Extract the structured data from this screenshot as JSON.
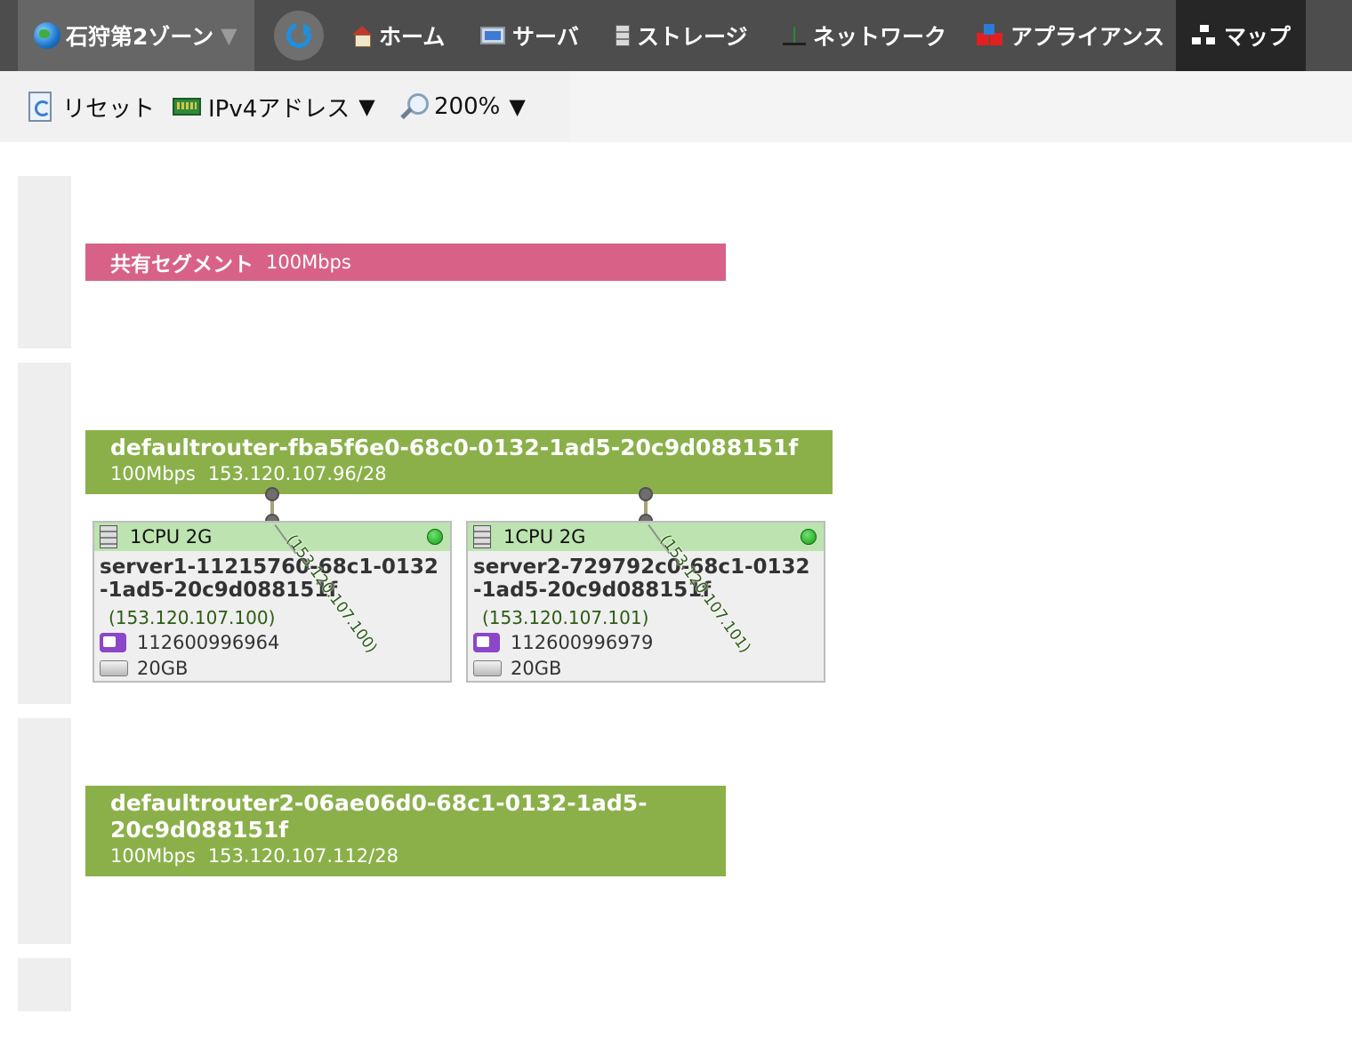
{
  "nav": {
    "zone": "石狩第2ゾーン",
    "zone_caret": "▼",
    "items": [
      {
        "label": "ホーム",
        "icon": "home-icon"
      },
      {
        "label": "サーバ",
        "icon": "server-icon"
      },
      {
        "label": "ストレージ",
        "icon": "storage-icon"
      },
      {
        "label": "ネットワーク",
        "icon": "network-icon"
      },
      {
        "label": "アプライアンス",
        "icon": "appliance-icon"
      },
      {
        "label": "マップ",
        "icon": "map-icon",
        "active": true
      }
    ]
  },
  "toolbar": {
    "reset": "リセット",
    "address_mode": "IPv4アドレス",
    "zoom": "200%",
    "caret": "▼"
  },
  "map": {
    "shared_segment": {
      "name": "共有セグメント",
      "bandwidth": "100Mbps",
      "color": "#d86287"
    },
    "routers": [
      {
        "name": "defaultrouter-fba5f6e0-68c0-0132-1ad5-20c9d088151f",
        "bandwidth": "100Mbps",
        "subnet": "153.120.107.96/28",
        "color": "#8bb04a"
      },
      {
        "name": "defaultrouter2-06ae06d0-68c1-0132-1ad5-20c9d088151f",
        "bandwidth": "100Mbps",
        "subnet": "153.120.107.112/28",
        "color": "#8bb04a"
      }
    ],
    "servers": [
      {
        "spec": "1CPU 2G",
        "name": "server1-11215760-68c1-0132-1ad5-20c9d088151f",
        "ip": "(153.120.107.100)",
        "id": "112600996964",
        "disk": "20GB",
        "connection_label": "(153.120.107.100)",
        "status": "up"
      },
      {
        "spec": "1CPU 2G",
        "name": "server2-729792c0-68c1-0132-1ad5-20c9d088151f",
        "ip": "(153.120.107.101)",
        "id": "112600996979",
        "disk": "20GB",
        "connection_label": "(153.120.107.101)",
        "status": "up"
      }
    ]
  }
}
